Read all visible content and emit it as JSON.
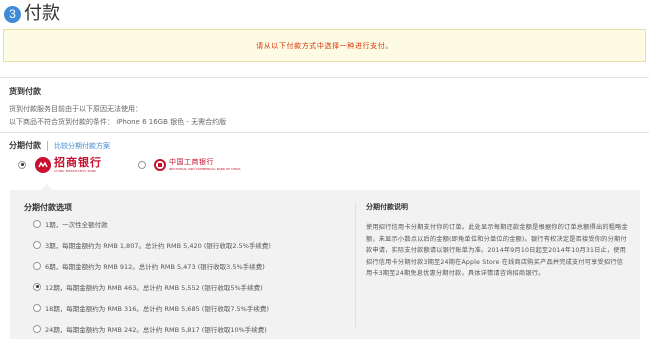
{
  "header": {
    "step_number": "3",
    "title": "付款"
  },
  "alert": {
    "text": "请从以下付款方式中选择一种进行支付。"
  },
  "cod": {
    "title": "货到付款",
    "lines": [
      "货到付款服务目前由于以下原因无法使用：",
      "以下商品不符合货到付款的条件： iPhone 6 16GB 银色 - 无需合约版"
    ]
  },
  "installment": {
    "title": "分期付款",
    "compare_link": "比较分期付款方案",
    "banks": [
      {
        "name": "招商银行",
        "en": "CHINA MERCHANTS BANK",
        "checked": true
      },
      {
        "name": "中国工商银行",
        "en": "INDUSTRIAL AND COMMERCIAL BANK OF CHINA",
        "checked": false
      }
    ],
    "options_title": "分期付款选项",
    "options": [
      {
        "label": "1期，一次性全额付款",
        "checked": false
      },
      {
        "label": "3期，每期金额约为 RMB 1,807。总计约 RMB 5,420 (银行收取2.5%手续费)",
        "checked": false
      },
      {
        "label": "6期，每期金额约为 RMB 912。总计约 RMB 5,473 (银行收取3.5%手续费)",
        "checked": false
      },
      {
        "label": "12期，每期金额约为 RMB 463。总计约 RMB 5,552 (银行收取5%手续费)",
        "checked": true
      },
      {
        "label": "18期，每期金额约为 RMB 316。总计约 RMB 5,685 (银行收取7.5%手续费)",
        "checked": false
      },
      {
        "label": "24期，每期金额约为 RMB 242。总计约 RMB 5,817 (银行收取10%手续费)",
        "checked": false
      }
    ],
    "desc_title": "分期付款说明",
    "desc_body": "使用招行信用卡分期支付你的订单。此处显示每期还款金额是根据你的订单总额得出的粗略金额，未显示小数点以后的金额(即角单位和分单位的金额)。银行有权决定是否接受你的分期付款申请，实际支付款额请以银行账单为准。2014年9月10日起至2014年10月31日止，使用招行信用卡分期付款3期至24期在Apple Store 在线商店购买产品并完成支付可享受招行信用卡3期至24期免息优惠分期付款，具体详情请咨询招商银行。"
  },
  "colors": {
    "accent": "#3f8bd7",
    "alert_text": "#d8310a",
    "bank_red": "#c8102e"
  }
}
